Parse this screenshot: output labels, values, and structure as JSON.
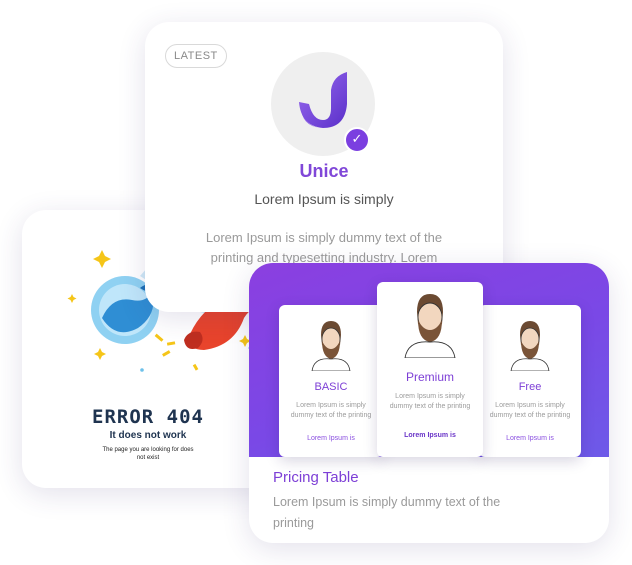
{
  "error_card": {
    "title": "ERROR 404",
    "subtitle": "It does not work",
    "description": "The page you are looking for does not exist",
    "icon": "comet-illustration"
  },
  "unice_card": {
    "badge": "LATEST",
    "title": "Unice",
    "subtitle": "Lorem Ipsum is simply",
    "description": "Lorem Ipsum is simply dummy text of the printing and typesetting industry. Lorem",
    "logo_icon": "unice-logo-icon",
    "check_icon": "check-icon",
    "accent_color": "#7b3fe0"
  },
  "pricing_card": {
    "title": "Pricing Table",
    "description": "Lorem Ipsum is simply dummy text of the printing",
    "gradient_start": "#8b3fe0",
    "gradient_end": "#6d5ae8",
    "plans": [
      {
        "name": "BASIC",
        "description": "Lorem Ipsum is simply dummy text of the printing",
        "link": "Lorem Ipsum is"
      },
      {
        "name": "Premium",
        "description": "Lorem Ipsum is simply dummy text of the printing",
        "link": "Lorem Ipsum is"
      },
      {
        "name": "Free",
        "description": "Lorem Ipsum is simply dummy text of the printing",
        "link": "Lorem Ipsum is"
      }
    ]
  }
}
